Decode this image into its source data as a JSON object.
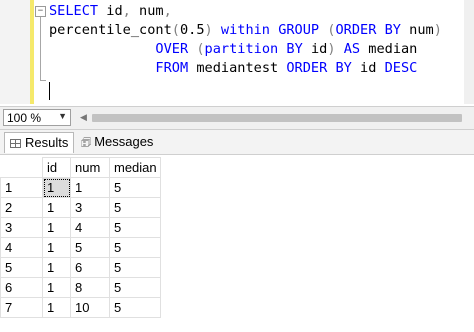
{
  "editor": {
    "code_lines": [
      [
        {
          "t": "SELECT",
          "c": "kw"
        },
        {
          "t": " id",
          "c": "fn"
        },
        {
          "t": ",",
          "c": "gr"
        },
        {
          "t": " num",
          "c": "fn"
        },
        {
          "t": ",",
          "c": "gr"
        }
      ],
      [
        {
          "t": "percentile_cont",
          "c": "fn"
        },
        {
          "t": "(",
          "c": "gr"
        },
        {
          "t": "0.5",
          "c": "num"
        },
        {
          "t": ")",
          "c": "gr"
        },
        {
          "t": " ",
          "c": "fn"
        },
        {
          "t": "within",
          "c": "kw"
        },
        {
          "t": " ",
          "c": "fn"
        },
        {
          "t": "GROUP",
          "c": "kw"
        },
        {
          "t": " ",
          "c": "fn"
        },
        {
          "t": "(",
          "c": "gr"
        },
        {
          "t": "ORDER",
          "c": "kw"
        },
        {
          "t": " ",
          "c": "fn"
        },
        {
          "t": "BY",
          "c": "kw"
        },
        {
          "t": " num",
          "c": "fn"
        },
        {
          "t": ")",
          "c": "gr"
        }
      ],
      [
        {
          "t": "             ",
          "c": "fn"
        },
        {
          "t": "OVER",
          "c": "kw"
        },
        {
          "t": " ",
          "c": "fn"
        },
        {
          "t": "(",
          "c": "gr"
        },
        {
          "t": "partition",
          "c": "kw"
        },
        {
          "t": " ",
          "c": "fn"
        },
        {
          "t": "BY",
          "c": "kw"
        },
        {
          "t": " id",
          "c": "fn"
        },
        {
          "t": ")",
          "c": "gr"
        },
        {
          "t": " ",
          "c": "fn"
        },
        {
          "t": "AS",
          "c": "kw"
        },
        {
          "t": " median",
          "c": "fn"
        }
      ],
      [
        {
          "t": "             ",
          "c": "fn"
        },
        {
          "t": "FROM",
          "c": "kw"
        },
        {
          "t": " mediantest ",
          "c": "fn"
        },
        {
          "t": "ORDER",
          "c": "kw"
        },
        {
          "t": " ",
          "c": "fn"
        },
        {
          "t": "BY",
          "c": "kw"
        },
        {
          "t": " id ",
          "c": "fn"
        },
        {
          "t": "DESC",
          "c": "kw"
        }
      ]
    ]
  },
  "zoom": {
    "value": "100 %"
  },
  "tabs": {
    "results": "Results",
    "messages": "Messages"
  },
  "results": {
    "columns": [
      "id",
      "num",
      "median"
    ],
    "rows": [
      {
        "n": "1",
        "id": "1",
        "num": "1",
        "median": "5"
      },
      {
        "n": "2",
        "id": "1",
        "num": "3",
        "median": "5"
      },
      {
        "n": "3",
        "id": "1",
        "num": "4",
        "median": "5"
      },
      {
        "n": "4",
        "id": "1",
        "num": "5",
        "median": "5"
      },
      {
        "n": "5",
        "id": "1",
        "num": "6",
        "median": "5"
      },
      {
        "n": "6",
        "id": "1",
        "num": "8",
        "median": "5"
      },
      {
        "n": "7",
        "id": "1",
        "num": "10",
        "median": "5"
      }
    ]
  },
  "colors": {
    "keyword": "#0000ff",
    "punctuation": "#808080",
    "change_bar": "#f5e96b",
    "selected_cell": "#dcdcdc"
  }
}
